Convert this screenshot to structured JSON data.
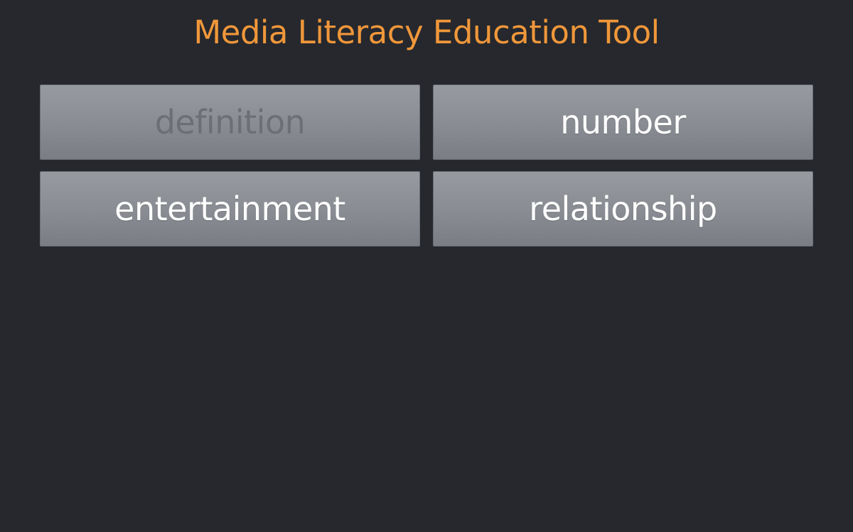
{
  "app": {
    "title": "Media Literacy Education Tool"
  },
  "buttons": [
    {
      "label": "definition",
      "state": "disabled"
    },
    {
      "label": "number",
      "state": "enabled"
    },
    {
      "label": "entertainment",
      "state": "enabled"
    },
    {
      "label": "relationship",
      "state": "enabled"
    }
  ],
  "colors": {
    "background": "#26282d",
    "title": "#f0973a",
    "button_text": "#ffffff",
    "button_text_disabled": "#6c6f73"
  }
}
